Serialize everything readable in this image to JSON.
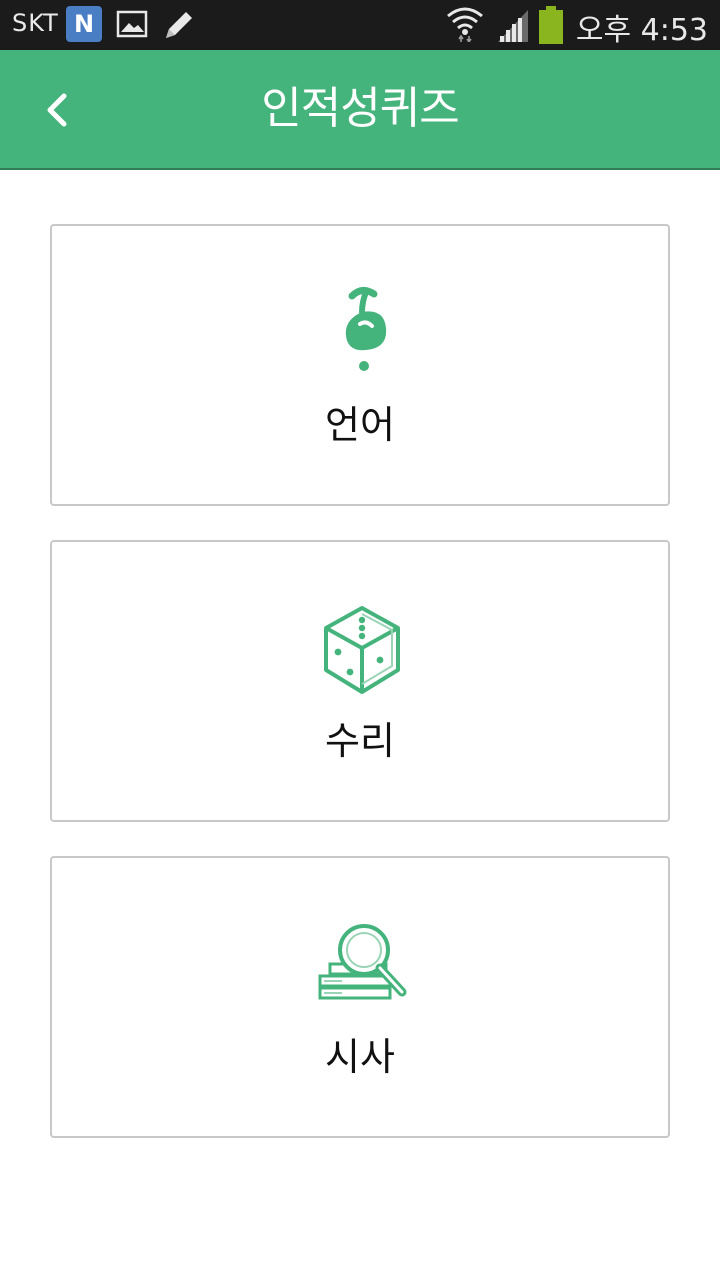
{
  "status_bar": {
    "carrier": "SKT",
    "n_badge": "N",
    "time": "오후 4:53",
    "icons": [
      "n-app-icon",
      "gallery-icon",
      "pencil-icon",
      "wifi-icon",
      "signal-icon",
      "battery-icon"
    ]
  },
  "app_bar": {
    "title": "인적성퀴즈",
    "back_icon": "chevron-left-icon"
  },
  "categories": [
    {
      "label": "언어",
      "icon": "language-icon"
    },
    {
      "label": "수리",
      "icon": "dice-icon"
    },
    {
      "label": "시사",
      "icon": "magnifier-books-icon"
    }
  ],
  "colors": {
    "accent": "#45b47c",
    "status_bar": "#1b1b1b",
    "card_border": "#c8c8c8"
  }
}
